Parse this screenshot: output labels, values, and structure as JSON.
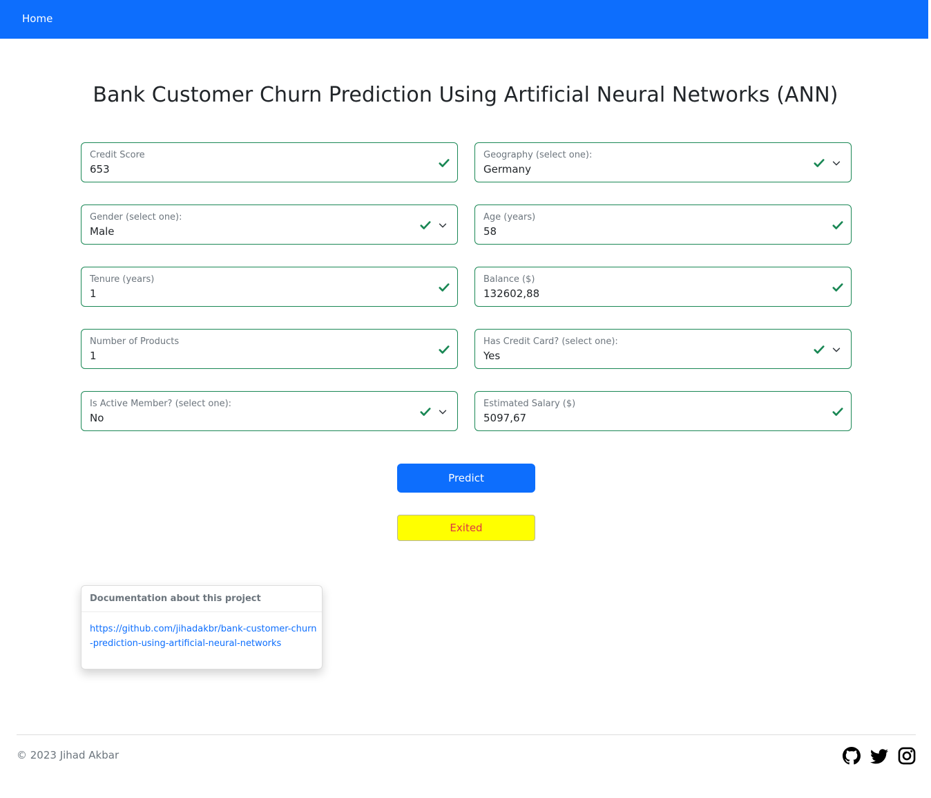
{
  "nav": {
    "home_label": "Home"
  },
  "page": {
    "title": "Bank Customer Churn Prediction Using Artificial Neural Networks (ANN)"
  },
  "form": {
    "credit_score": {
      "label": "Credit Score",
      "value": "653"
    },
    "geography": {
      "label": "Geography (select one):",
      "value": "Germany"
    },
    "gender": {
      "label": "Gender (select one):",
      "value": "Male"
    },
    "age": {
      "label": "Age (years)",
      "value": "58"
    },
    "tenure": {
      "label": "Tenure (years)",
      "value": "1"
    },
    "balance": {
      "label": "Balance ($)",
      "value": "132602,88"
    },
    "num_products": {
      "label": "Number of Products",
      "value": "1"
    },
    "has_credit_card": {
      "label": "Has Credit Card? (select one):",
      "value": "Yes"
    },
    "is_active_member": {
      "label": "Is Active Member? (select one):",
      "value": "No"
    },
    "estimated_salary": {
      "label": "Estimated Salary ($)",
      "value": "5097,67"
    }
  },
  "predict_button": {
    "label": "Predict"
  },
  "result": {
    "text": "Exited"
  },
  "documentation": {
    "header": "Documentation about this project",
    "link": "https://github.com/jihadakbr/bank-customer-churn-prediction-using-artificial-neural-networks"
  },
  "footer": {
    "copyright": "© 2023 Jihad Akbar",
    "social_icons": [
      "github-icon",
      "twitter-icon",
      "instagram-icon"
    ]
  },
  "colors": {
    "primary": "#0d6efd",
    "valid": "#198754",
    "result_background": "#ffff00",
    "result_text": "#dc3545"
  }
}
